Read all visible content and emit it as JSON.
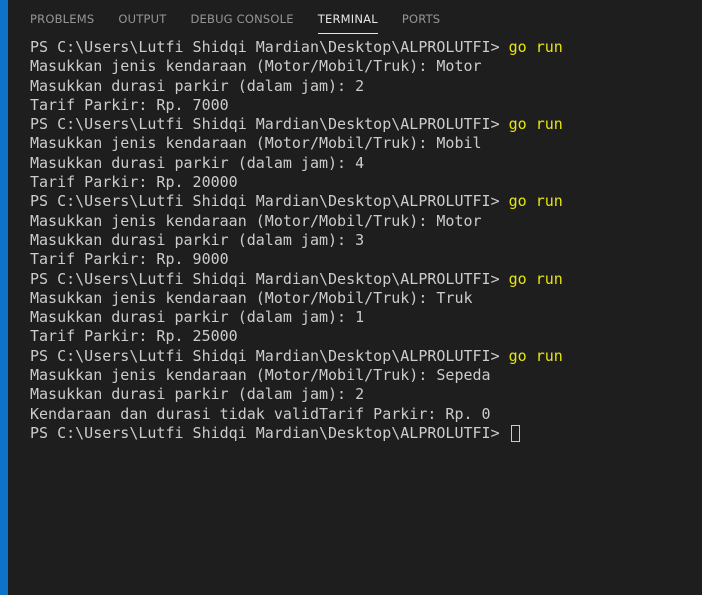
{
  "tabs": [
    {
      "label": "PROBLEMS",
      "active": false
    },
    {
      "label": "OUTPUT",
      "active": false
    },
    {
      "label": "DEBUG CONSOLE",
      "active": false
    },
    {
      "label": "TERMINAL",
      "active": true
    },
    {
      "label": "PORTS",
      "active": false
    }
  ],
  "terminal": {
    "prompt": "PS C:\\Users\\Lutfi Shidqi Mardian\\Desktop\\ALPROLUTFI> ",
    "command": "go run",
    "lines": [
      {
        "kind": "prompt"
      },
      {
        "kind": "output",
        "text": "Masukkan jenis kendaraan (Motor/Mobil/Truk): Motor"
      },
      {
        "kind": "output",
        "text": "Masukkan durasi parkir (dalam jam): 2"
      },
      {
        "kind": "output",
        "text": "Tarif Parkir: Rp. 7000"
      },
      {
        "kind": "prompt"
      },
      {
        "kind": "output",
        "text": "Masukkan jenis kendaraan (Motor/Mobil/Truk): Mobil"
      },
      {
        "kind": "output",
        "text": "Masukkan durasi parkir (dalam jam): 4"
      },
      {
        "kind": "output",
        "text": "Tarif Parkir: Rp. 20000"
      },
      {
        "kind": "prompt"
      },
      {
        "kind": "output",
        "text": "Masukkan jenis kendaraan (Motor/Mobil/Truk): Motor"
      },
      {
        "kind": "output",
        "text": "Masukkan durasi parkir (dalam jam): 3"
      },
      {
        "kind": "output",
        "text": "Tarif Parkir: Rp. 9000"
      },
      {
        "kind": "prompt"
      },
      {
        "kind": "output",
        "text": "Masukkan jenis kendaraan (Motor/Mobil/Truk): Truk"
      },
      {
        "kind": "output",
        "text": "Masukkan durasi parkir (dalam jam): 1"
      },
      {
        "kind": "output",
        "text": "Tarif Parkir: Rp. 25000"
      },
      {
        "kind": "prompt"
      },
      {
        "kind": "output",
        "text": "Masukkan jenis kendaraan (Motor/Mobil/Truk): Sepeda"
      },
      {
        "kind": "output",
        "text": "Masukkan durasi parkir (dalam jam): 2"
      },
      {
        "kind": "output",
        "text": "Kendaraan dan durasi tidak validTarif Parkir: Rp. 0"
      },
      {
        "kind": "final-prompt"
      }
    ]
  },
  "colors": {
    "background": "#1e1e1e",
    "text": "#cccccc",
    "command": "#e5e510",
    "accent": "#0e73c7",
    "tab_inactive": "#969696",
    "tab_active": "#e7e7e7"
  }
}
